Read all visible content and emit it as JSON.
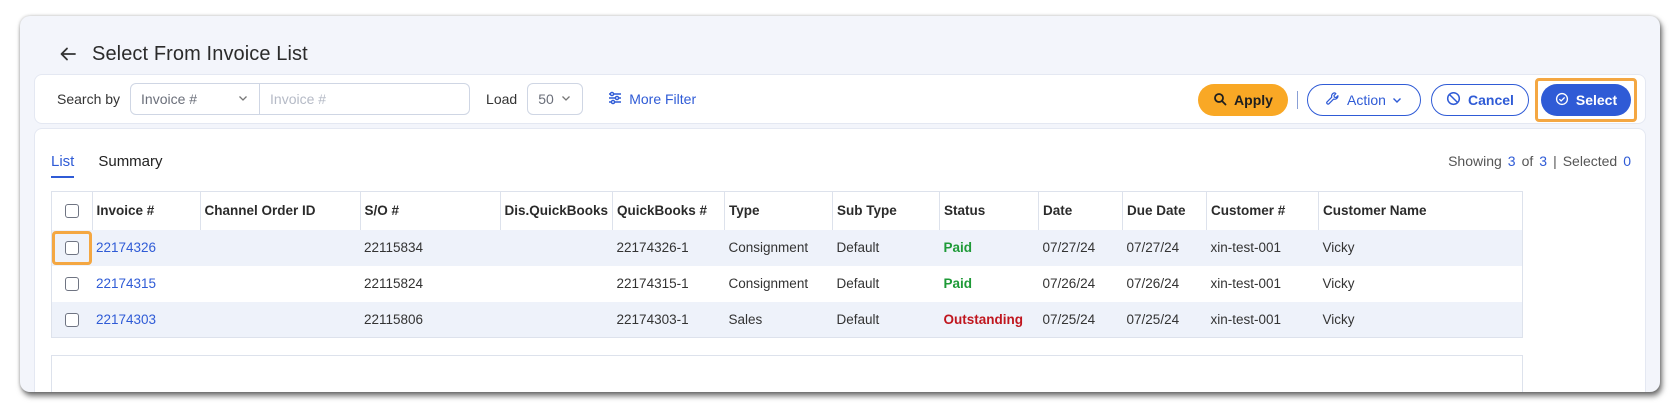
{
  "header": {
    "title": "Select From Invoice List"
  },
  "filter": {
    "search_by_label": "Search by",
    "search_field_value": "Invoice #",
    "search_placeholder": "Invoice #",
    "load_label": "Load",
    "load_value": "50",
    "more_filter_label": "More Filter"
  },
  "actions": {
    "apply_label": "Apply",
    "action_label": "Action",
    "cancel_label": "Cancel",
    "select_label": "Select"
  },
  "tabs": [
    {
      "label": "List",
      "active": true
    },
    {
      "label": "Summary",
      "active": false
    }
  ],
  "summary": {
    "showing_label": "Showing",
    "showing_count": "3",
    "of_label": "of",
    "total_count": "3",
    "separator": "|",
    "selected_label": "Selected",
    "selected_count": "0"
  },
  "table": {
    "columns": [
      "Invoice #",
      "Channel Order ID",
      "S/O #",
      "Dis.QuickBooks",
      "QuickBooks #",
      "Type",
      "Sub Type",
      "Status",
      "Date",
      "Due Date",
      "Customer #",
      "Customer Name"
    ],
    "rows": [
      {
        "invoice": "22174326",
        "channel_order_id": "",
        "so": "22115834",
        "dis_quickbooks": "",
        "quickbooks": "22174326-1",
        "type": "Consignment",
        "sub_type": "Default",
        "status": "Paid",
        "date": "07/27/24",
        "due_date": "07/27/24",
        "customer_no": "xin-test-001",
        "customer_name": "Vicky"
      },
      {
        "invoice": "22174315",
        "channel_order_id": "",
        "so": "22115824",
        "dis_quickbooks": "",
        "quickbooks": "22174315-1",
        "type": "Consignment",
        "sub_type": "Default",
        "status": "Paid",
        "date": "07/26/24",
        "due_date": "07/26/24",
        "customer_no": "xin-test-001",
        "customer_name": "Vicky"
      },
      {
        "invoice": "22174303",
        "channel_order_id": "",
        "so": "22115806",
        "dis_quickbooks": "",
        "quickbooks": "22174303-1",
        "type": "Sales",
        "sub_type": "Default",
        "status": "Outstanding",
        "date": "07/25/24",
        "due_date": "07/25/24",
        "customer_no": "xin-test-001",
        "customer_name": "Vicky"
      }
    ]
  },
  "colors": {
    "accent": "#2f5bd6",
    "apply": "#f9a825",
    "highlight": "#f4a742",
    "paid": "#1e9a37",
    "outstanding": "#c0161e"
  },
  "icons": [
    "back-arrow-icon",
    "chevron-down-icon",
    "sliders-icon",
    "search-icon",
    "wrench-icon",
    "ban-icon",
    "check-circle-icon"
  ]
}
